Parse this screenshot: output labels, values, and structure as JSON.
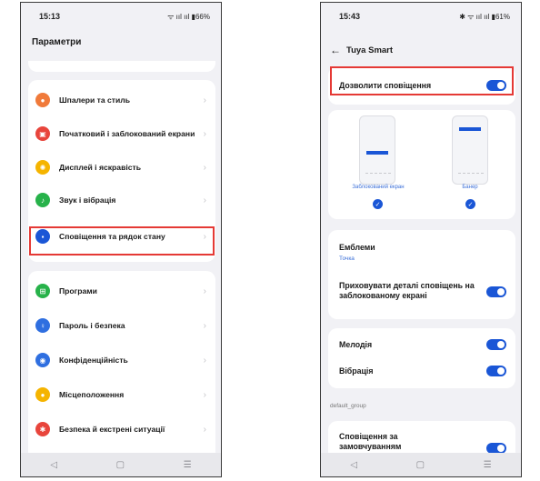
{
  "left": {
    "status_time": "15:13",
    "status_icons": "ᯤ ııl ııl ▮66%",
    "title": "Параметри",
    "group1": [
      {
        "label": "Шпалери та стиль",
        "icon": "palette-icon",
        "color": "#f07a3a"
      },
      {
        "label": "Початковий і заблокований екрани",
        "icon": "image-icon",
        "color": "#e8453c"
      },
      {
        "label": "Дисплей і яскравість",
        "icon": "sun-icon",
        "color": "#f5b400"
      },
      {
        "label": "Звук і вібрація",
        "icon": "bell-icon",
        "color": "#27b24a"
      },
      {
        "label": "Сповіщення та рядок стану",
        "icon": "notification-icon",
        "color": "#1a56d6"
      }
    ],
    "group2": [
      {
        "label": "Програми",
        "icon": "apps-icon",
        "color": "#27b24a"
      },
      {
        "label": "Пароль і безпека",
        "icon": "key-icon",
        "color": "#2f6fe0"
      },
      {
        "label": "Конфіденційність",
        "icon": "privacy-icon",
        "color": "#2f6fe0"
      },
      {
        "label": "Місцеположення",
        "icon": "location-icon",
        "color": "#f5b400"
      },
      {
        "label": "Безпека й екстрені ситуації",
        "icon": "emergency-icon",
        "color": "#e8453c"
      }
    ],
    "chevron": "›"
  },
  "right": {
    "status_time": "15:43",
    "status_icons": "✱ ᯤ ııl ııl ▮61%",
    "header_title": "Tuya Smart",
    "allow_notifications": "Дозволити сповіщення",
    "lock_screen_caption": "Заблокований екран",
    "banner_caption": "Банер",
    "badges_label": "Емблеми",
    "badges_value": "Точка",
    "hide_details": "Приховувати деталі сповіщень на заблокованому екрані",
    "ringtone": "Мелодія",
    "vibration": "Вібрація",
    "group_label": "default_group",
    "default_notifications": "Сповіщення за замовчуванням"
  },
  "nav": {
    "back": "◁",
    "home": "▢",
    "menu": "☰"
  },
  "colors": {
    "accent": "#1a56d6",
    "highlight": "#e53935"
  }
}
